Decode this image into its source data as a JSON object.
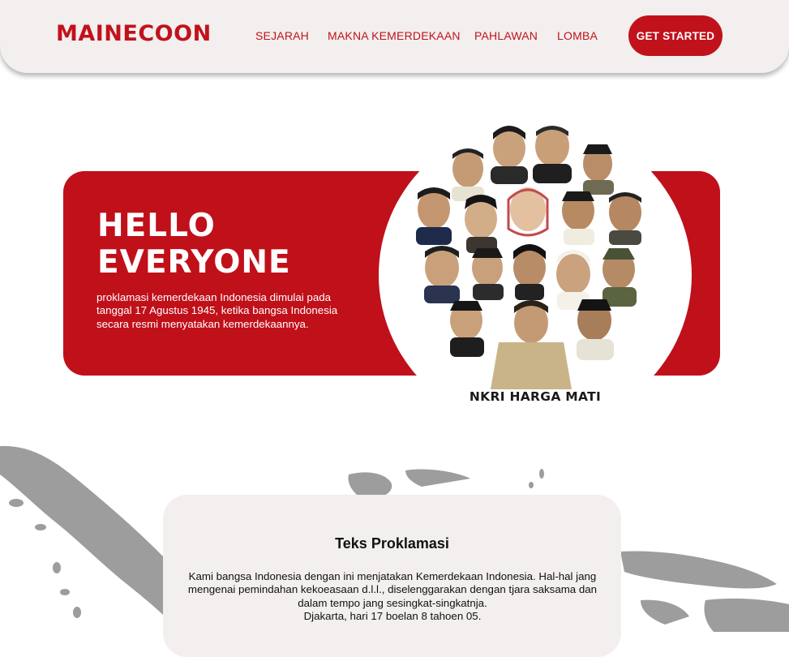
{
  "brand": {
    "logo": "MAINECOON",
    "accent": "#c1121c"
  },
  "nav": {
    "items": [
      "SEJARAH",
      "MAKNA KEMERDEKAAN",
      "PAHLAWAN",
      "LOMBA"
    ],
    "cta": "GET STARTED"
  },
  "hero": {
    "title_line1": "HELLO",
    "title_line2": "EVERYONE",
    "text": "proklamasi kemerdekaan Indonesia dimulai pada tanggal 17 Agustus 1945, ketika bangsa Indonesia secara resmi menyatakan kemerdekaannya.",
    "image_caption": "NKRI HARGA MATI"
  },
  "proclamation": {
    "title": "Teks Proklamasi",
    "body_line1": "Kami bangsa Indonesia dengan ini menjatakan Kemerdekaan Indonesia. Hal-hal jang mengenai pemindahan kekoeasaan d.l.l., diselenggarakan dengan tjara saksama dan dalam tempo jang sesingkat-singkatnja.",
    "body_line2": "Djakarta, hari 17 boelan 8 tahoen 05."
  }
}
